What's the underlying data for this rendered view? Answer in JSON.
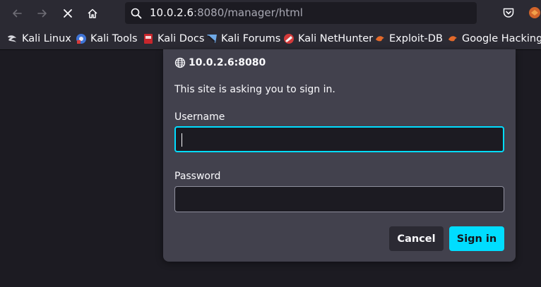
{
  "browser": {
    "url_host": "10.0.2.6",
    "url_rest": ":8080/manager/html",
    "icons": [
      "back-arrow-icon",
      "forward-arrow-icon",
      "stop-icon",
      "home-icon",
      "search-icon",
      "pocket-icon",
      "extension-icon"
    ]
  },
  "bookmarks": [
    {
      "label": "Kali Linux",
      "icon": "kali-dragon-icon"
    },
    {
      "label": "Kali Tools",
      "icon": "kali-tools-icon"
    },
    {
      "label": "Kali Docs",
      "icon": "kali-docs-icon"
    },
    {
      "label": "Kali Forums",
      "icon": "kali-forums-icon"
    },
    {
      "label": "Kali NetHunter",
      "icon": "kali-nethunter-icon"
    },
    {
      "label": "Exploit-DB",
      "icon": "exploit-db-icon"
    },
    {
      "label": "Google Hacking D",
      "icon": "ghdb-icon"
    }
  ],
  "dialog": {
    "origin": "10.0.2.6:8080",
    "message": "This site is asking you to sign in.",
    "username_label": "Username",
    "username_value": "",
    "password_label": "Password",
    "password_value": "",
    "cancel_label": "Cancel",
    "signin_label": "Sign in",
    "accent_color": "#00ddff"
  }
}
